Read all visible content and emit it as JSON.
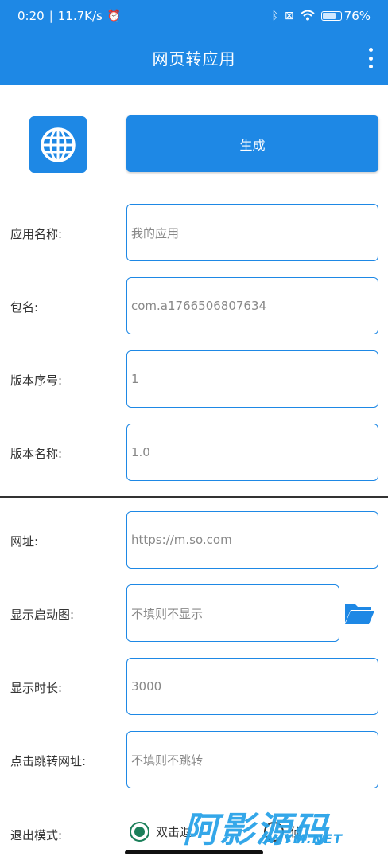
{
  "status_bar": {
    "time": "0:20",
    "net_speed": "11.7K/s",
    "battery_percent": "76%",
    "battery_level": 0.76
  },
  "app_bar": {
    "title": "网页转应用"
  },
  "actions": {
    "generate_label": "生成"
  },
  "form": {
    "app_name": {
      "label": "应用名称:",
      "value": "我的应用"
    },
    "package_name": {
      "label": "包名:",
      "value": "com.a1766506807634"
    },
    "version_code": {
      "label": "版本序号:",
      "value": "1"
    },
    "version_name": {
      "label": "版本名称:",
      "value": "1.0"
    },
    "url": {
      "label": "网址:",
      "value": "https://m.so.com"
    },
    "splash_image": {
      "label": "显示启动图:",
      "placeholder": "不填则不显示"
    },
    "splash_duration": {
      "label": "显示时长:",
      "value": "3000"
    },
    "click_url": {
      "label": "点击跳转网址:",
      "placeholder": "不填则不跳转"
    },
    "exit_mode": {
      "label": "退出模式:",
      "options": [
        "双击退",
        "侦"
      ],
      "selected": "双击退"
    }
  },
  "watermark": {
    "text": "阿影源码",
    "sub": "AYYM.NET"
  },
  "colors": {
    "primary": "#1e88e5",
    "radio_selected": "#1b7f5a"
  }
}
